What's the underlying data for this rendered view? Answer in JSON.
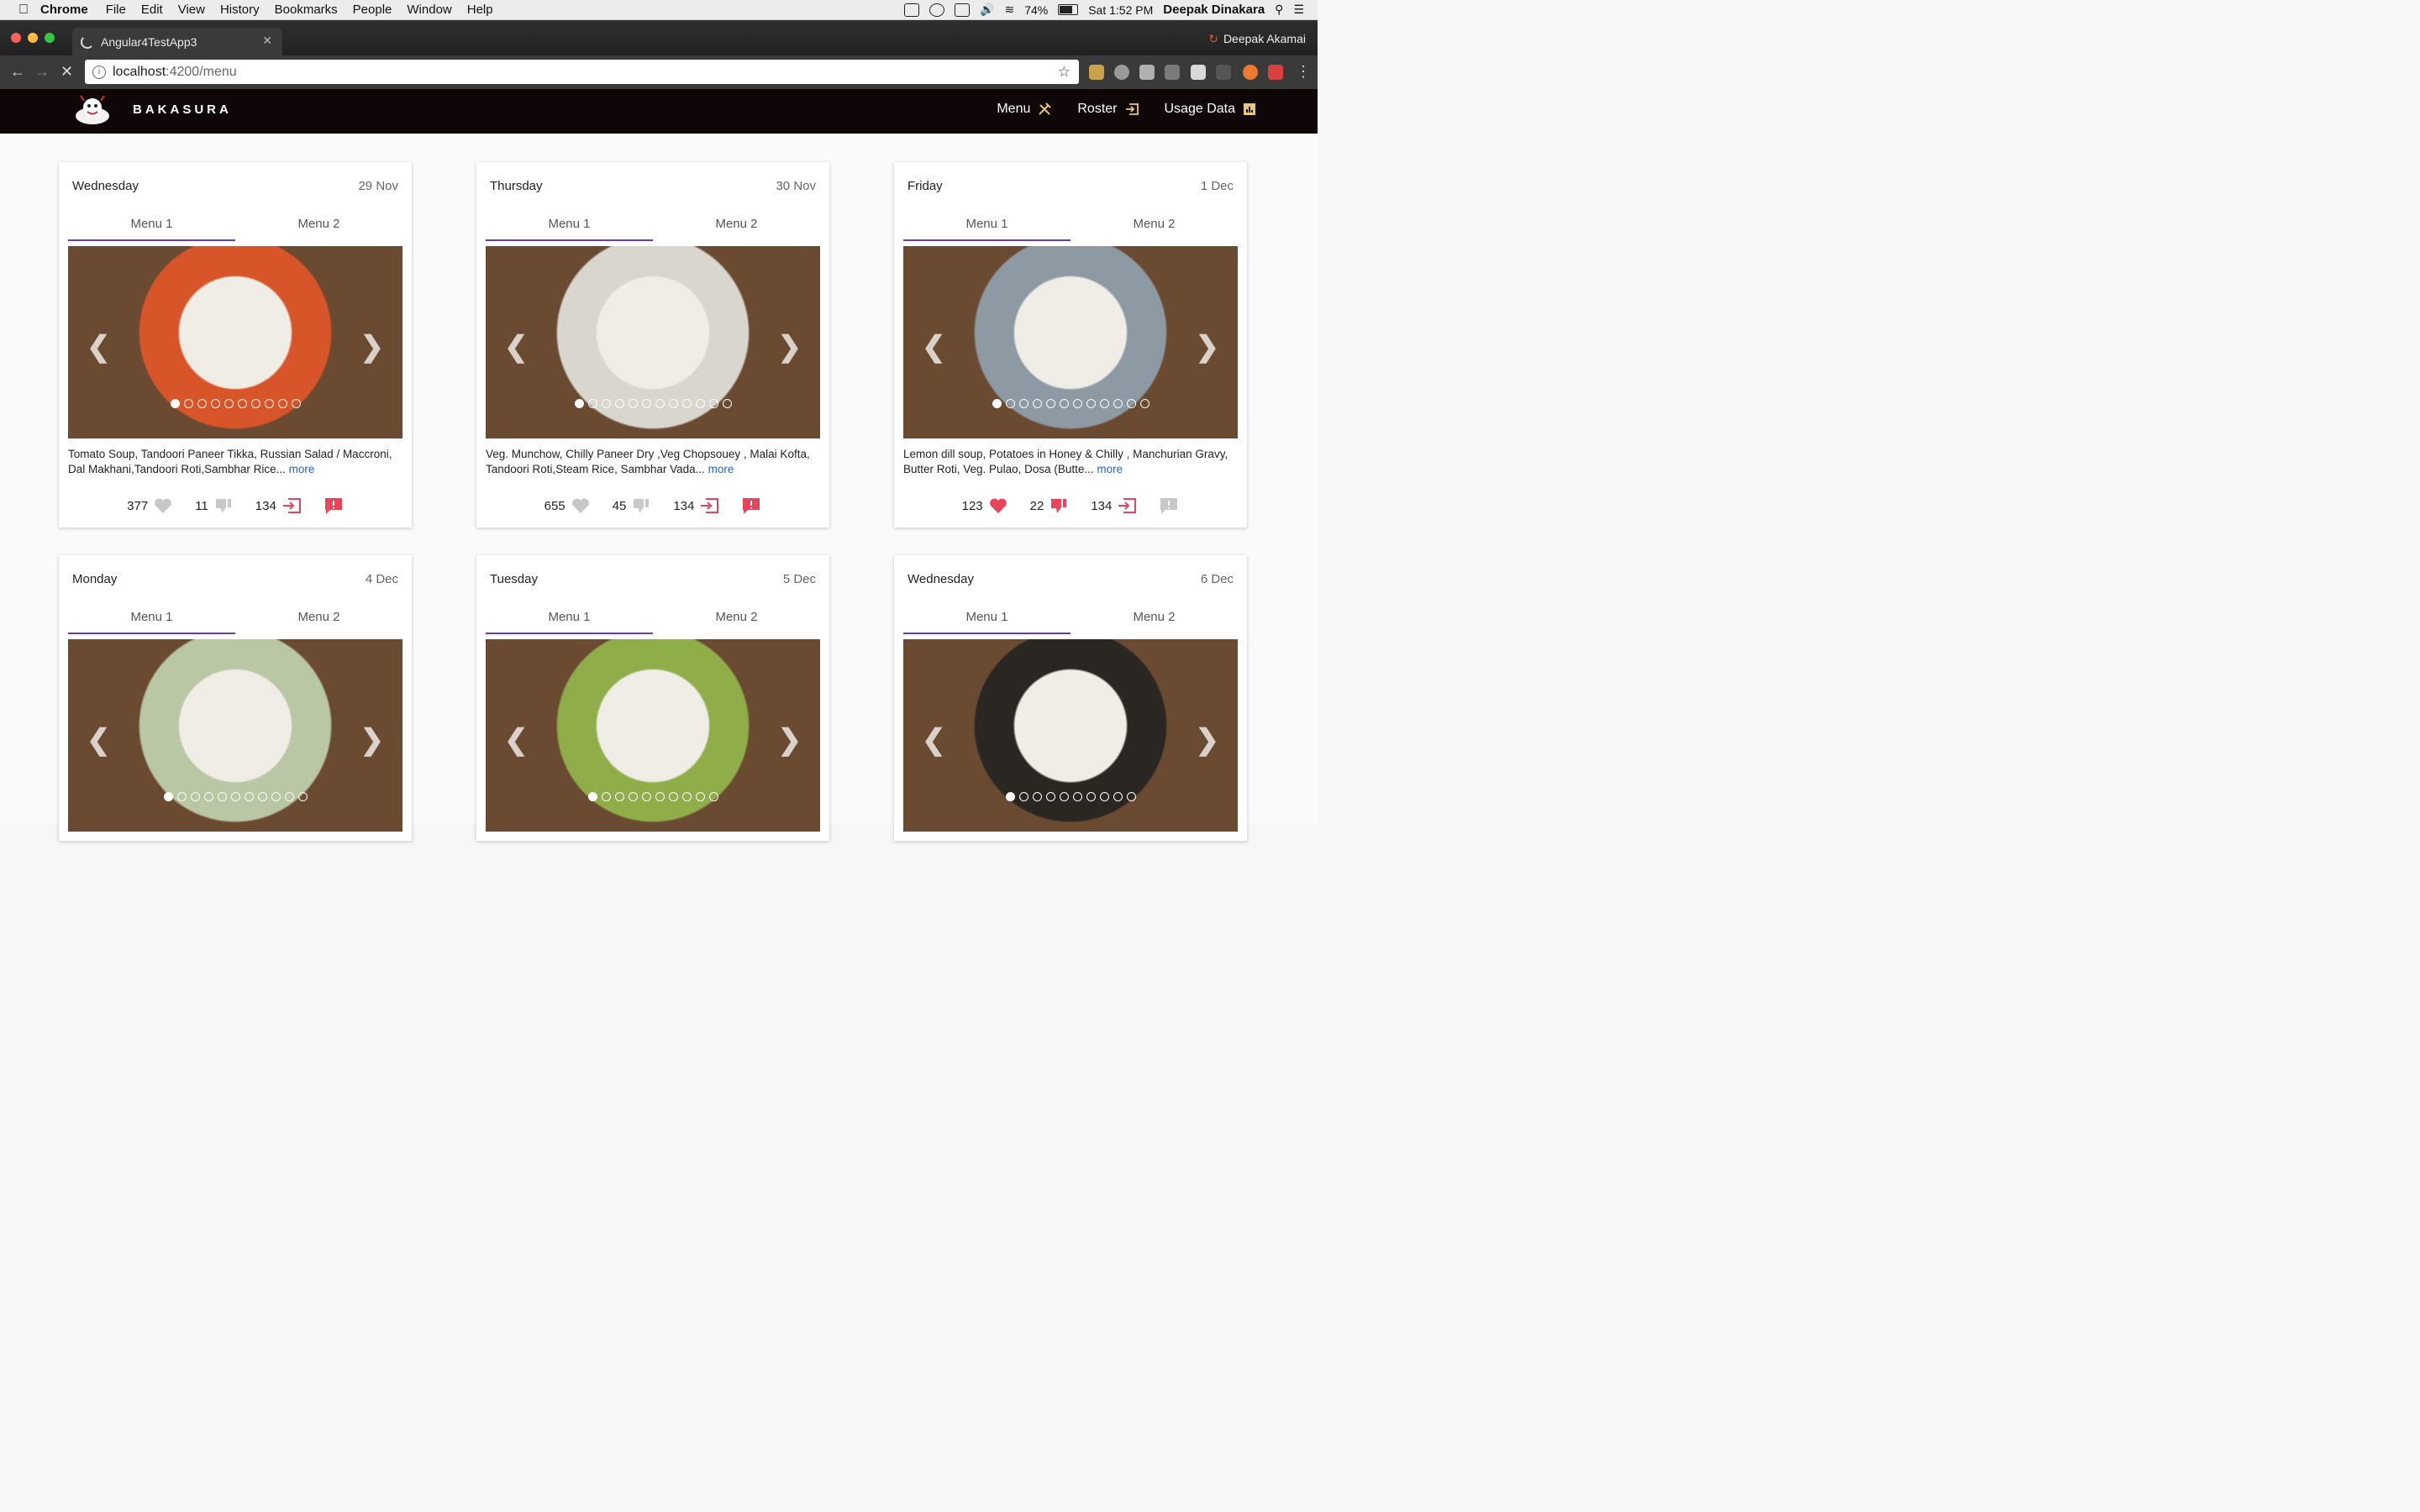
{
  "menubar": {
    "app": "Chrome",
    "items": [
      "File",
      "Edit",
      "View",
      "History",
      "Bookmarks",
      "People",
      "Window",
      "Help"
    ],
    "battery": "74%",
    "clock": "Sat 1:52 PM",
    "user": "Deepak Dinakara"
  },
  "browser": {
    "tab_title": "Angular4TestApp3",
    "profile": "Deepak Akamai",
    "url_host": "localhost",
    "url_path": ":4200/menu"
  },
  "app": {
    "brand": "BAKASURA",
    "nav": [
      {
        "label": "Menu",
        "icon": "utensils-icon"
      },
      {
        "label": "Roster",
        "icon": "login-icon"
      },
      {
        "label": "Usage Data",
        "icon": "bar-chart-icon"
      }
    ]
  },
  "cards": [
    {
      "day": "Wednesday",
      "date": "29 Nov",
      "tab1": "Menu 1",
      "tab2": "Menu 2",
      "desc": "Tomato Soup, Tandoori Paneer Tikka, Russian Salad / Maccroni, Dal Makhani,Tandoori Roti,Sambhar Rice...",
      "more": "more",
      "likes": "377",
      "dislikes": "11",
      "count": "134",
      "liked": false,
      "disliked": false,
      "report_on": true,
      "dots": 10,
      "photo": "#d8552a"
    },
    {
      "day": "Thursday",
      "date": "30 Nov",
      "tab1": "Menu 1",
      "tab2": "Menu 2",
      "desc": "Veg. Munchow, Chilly Paneer Dry ,Veg Chopsouey , Malai Kofta, Tandoori Roti,Steam Rice, Sambhar Vada...",
      "more": "more",
      "likes": "655",
      "dislikes": "45",
      "count": "134",
      "liked": false,
      "disliked": false,
      "report_on": true,
      "dots": 12,
      "photo": "#d9d6cf"
    },
    {
      "day": "Friday",
      "date": "1 Dec",
      "tab1": "Menu 1",
      "tab2": "Menu 2",
      "desc": "Lemon dill soup, Potatoes in Honey & Chilly , Manchurian Gravy, Butter Roti, Veg. Pulao, Dosa (Butte...",
      "more": "more",
      "likes": "123",
      "dislikes": "22",
      "count": "134",
      "liked": true,
      "disliked": true,
      "report_on": false,
      "dots": 12,
      "photo": "#8e9aa3"
    },
    {
      "day": "Monday",
      "date": "4 Dec",
      "tab1": "Menu 1",
      "tab2": "Menu 2",
      "photo": "#b9c7a4",
      "dots": 11
    },
    {
      "day": "Tuesday",
      "date": "5 Dec",
      "tab1": "Menu 1",
      "tab2": "Menu 2",
      "photo": "#8fae4a",
      "dots": 10
    },
    {
      "day": "Wednesday",
      "date": "6 Dec",
      "tab1": "Menu 1",
      "tab2": "Menu 2",
      "photo": "#2a2622",
      "dots": 10
    }
  ],
  "colors": {
    "accent": "#673ab7",
    "like": "#e8445a",
    "muted": "#c8c8c8",
    "link": "#2a64c8"
  }
}
